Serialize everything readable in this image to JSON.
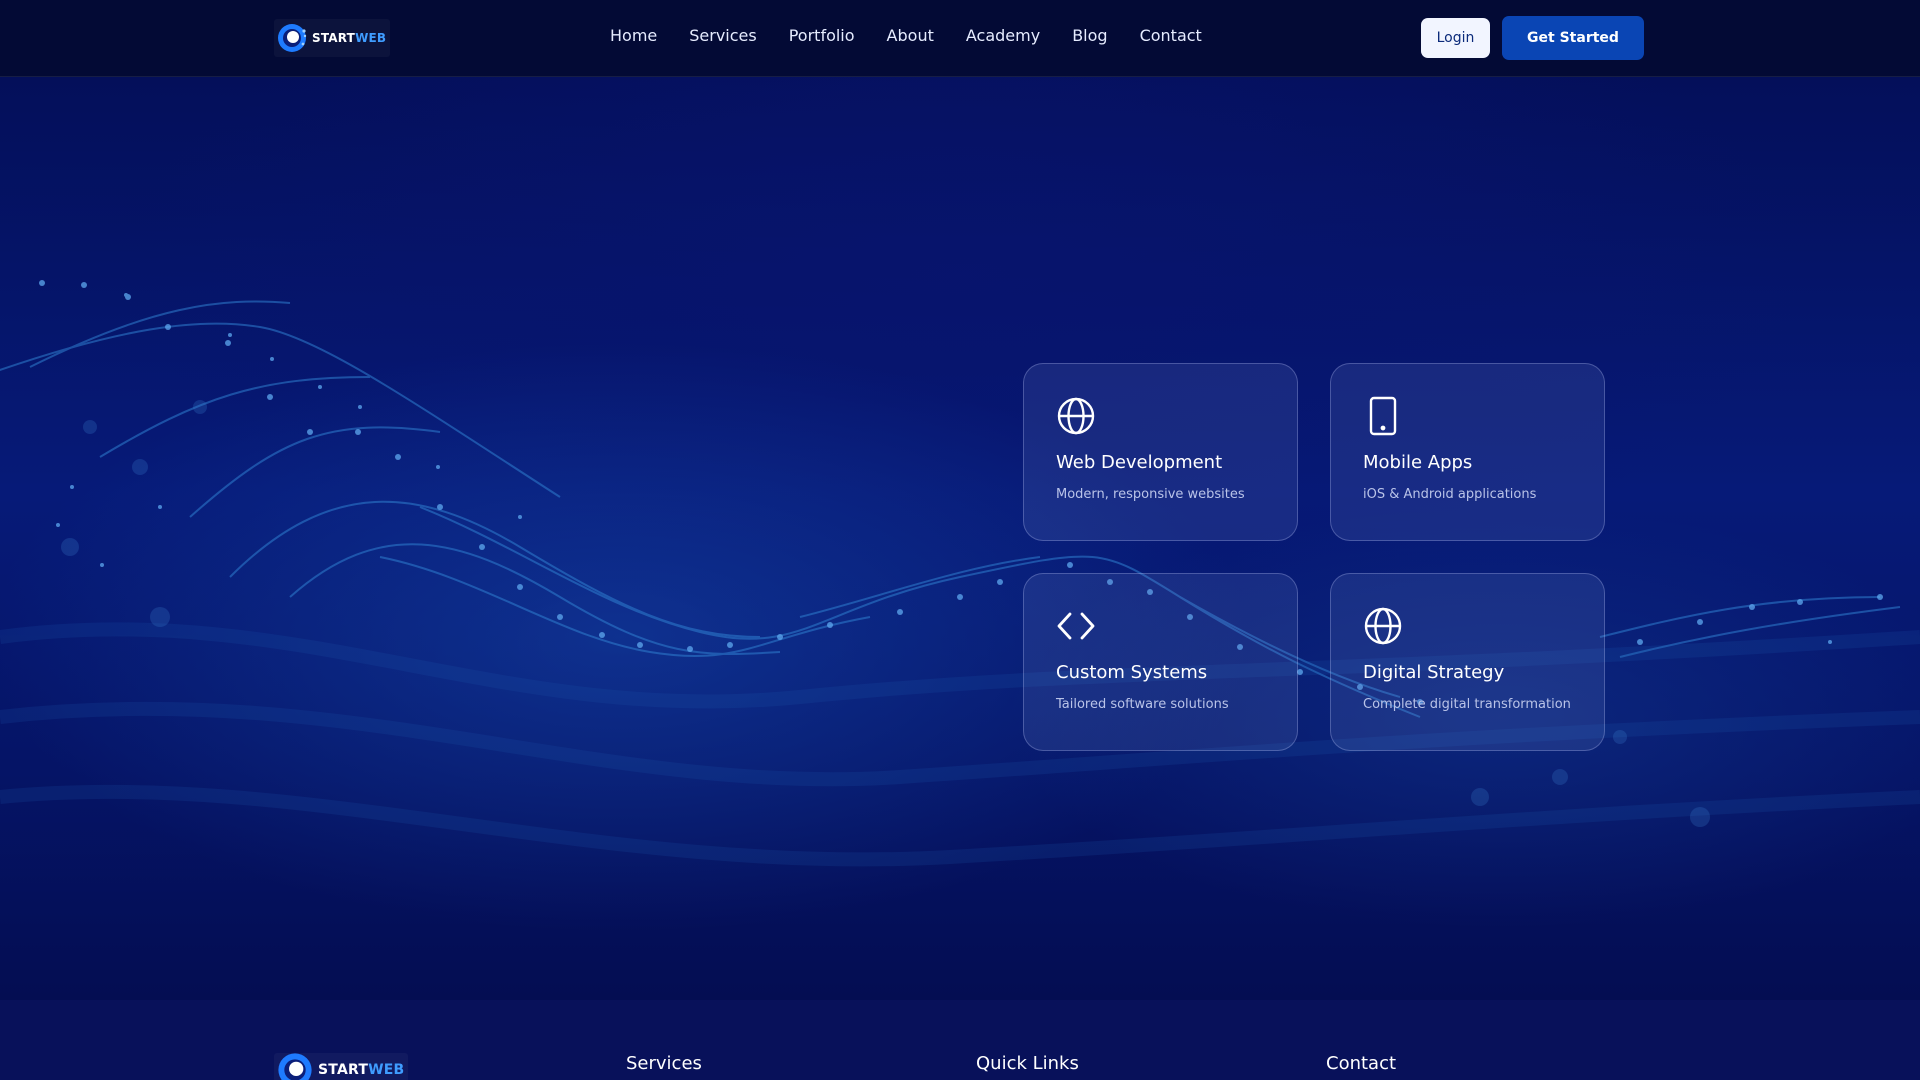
{
  "header": {
    "logo": {
      "part1": "START",
      "part2": "WEB"
    },
    "nav": [
      "Home",
      "Services",
      "Portfolio",
      "About",
      "Academy",
      "Blog",
      "Contact"
    ],
    "login_label": "Login",
    "get_started_label": "Get Started"
  },
  "cards": [
    {
      "icon": "globe-icon",
      "title": "Web Development",
      "desc": "Modern, responsive websites"
    },
    {
      "icon": "mobile-icon",
      "title": "Mobile Apps",
      "desc": "iOS & Android applications"
    },
    {
      "icon": "code-icon",
      "title": "Custom Systems",
      "desc": "Tailored software solutions"
    },
    {
      "icon": "globe-icon",
      "title": "Digital Strategy",
      "desc": "Complete digital transformation"
    }
  ],
  "footer": {
    "logo": {
      "part1": "START",
      "part2": "WEB"
    },
    "headings": [
      "Services",
      "Quick Links",
      "Contact"
    ]
  },
  "colors": {
    "background": "#040b3a",
    "accent": "#0a45b4",
    "logo_blue": "#3f9cff"
  }
}
